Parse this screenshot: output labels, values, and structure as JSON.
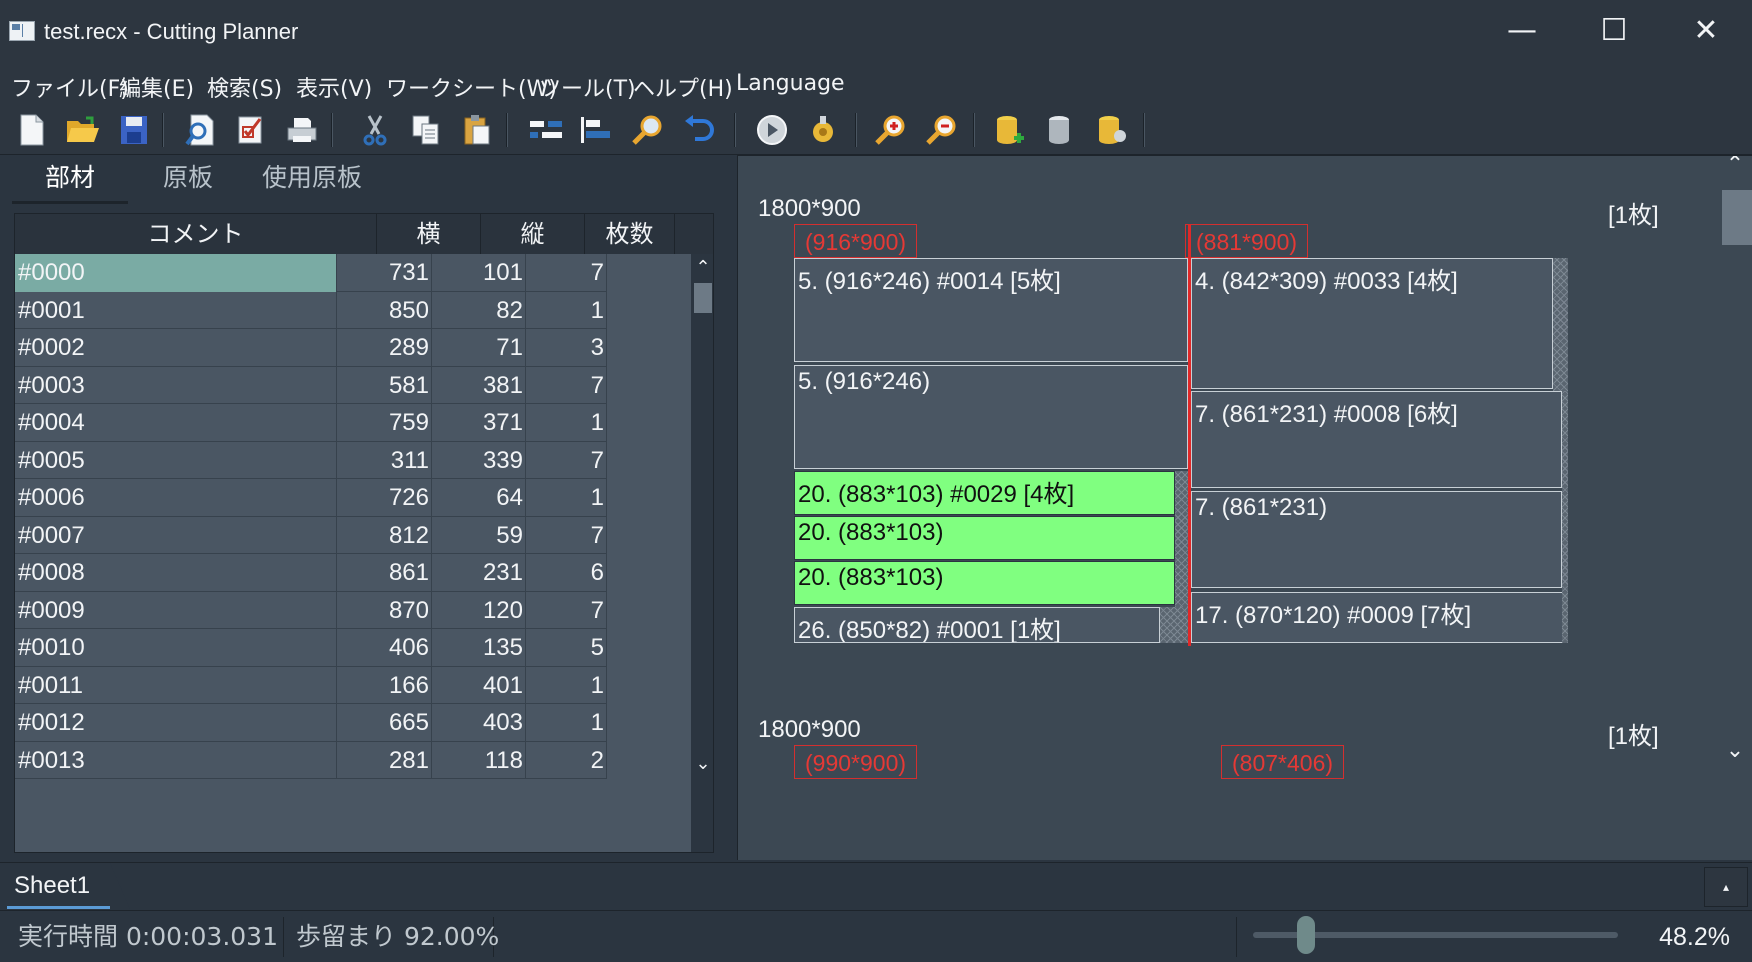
{
  "window": {
    "title": "test.recx - Cutting Planner",
    "minimize_glyph": "—",
    "maximize_glyph": "☐",
    "close_glyph": "✕"
  },
  "menu": [
    "ファイル(F)",
    "編集(E)",
    "検索(S)",
    "表示(V)",
    "ワークシート(W)",
    "ツール(T)",
    "ヘルプ(H)",
    "Language"
  ],
  "toolbar": {
    "icons": [
      "new-file-icon",
      "open-folder-icon",
      "save-icon",
      "print-preview-icon",
      "checklist-icon",
      "print-icon",
      "cut-icon",
      "copy-icon",
      "paste-icon",
      "align-center-icon",
      "align-left-icon",
      "search-icon",
      "undo-icon",
      "run-icon",
      "settings-gear-icon",
      "zoom-in-icon",
      "zoom-out-icon",
      "add-database-icon",
      "database-icon",
      "database-settings-icon"
    ]
  },
  "left_tabs": [
    "部材",
    "原板",
    "使用原板"
  ],
  "grid": {
    "headers": [
      "コメント",
      "横",
      "縦",
      "枚数"
    ],
    "rows": [
      [
        "#0000",
        "731",
        "101",
        "7"
      ],
      [
        "#0001",
        "850",
        "82",
        "1"
      ],
      [
        "#0002",
        "289",
        "71",
        "3"
      ],
      [
        "#0003",
        "581",
        "381",
        "7"
      ],
      [
        "#0004",
        "759",
        "371",
        "1"
      ],
      [
        "#0005",
        "311",
        "339",
        "7"
      ],
      [
        "#0006",
        "726",
        "64",
        "1"
      ],
      [
        "#0007",
        "812",
        "59",
        "7"
      ],
      [
        "#0008",
        "861",
        "231",
        "6"
      ],
      [
        "#0009",
        "870",
        "120",
        "7"
      ],
      [
        "#0010",
        "406",
        "135",
        "5"
      ],
      [
        "#0011",
        "166",
        "401",
        "1"
      ],
      [
        "#0012",
        "665",
        "403",
        "1"
      ],
      [
        "#0013",
        "281",
        "118",
        "2"
      ]
    ],
    "scroll_up": "⌃",
    "scroll_down": "⌄"
  },
  "layout_view": {
    "sheet1": {
      "size": "1800*900",
      "count": "[1枚]",
      "strip_left": "(916*900)",
      "strip_right": "(881*900)",
      "parts": [
        "5. (916*246) #0014 [5枚]",
        "5. (916*246)",
        "20. (883*103) #0029 [4枚]",
        "20. (883*103)",
        "20. (883*103)",
        "26. (850*82) #0001 [1枚]",
        "4. (842*309) #0033 [4枚]",
        "7. (861*231) #0008 [6枚]",
        "7. (861*231)",
        "17. (870*120) #0009 [7枚]"
      ]
    },
    "sheet2": {
      "size": "1800*900",
      "count": "[1枚]",
      "strip_left": "(990*900)",
      "strip_right": "(807*406)"
    },
    "scroll_up": "⌃",
    "scroll_down": "⌄"
  },
  "sheet_tabs": [
    "Sheet1"
  ],
  "sheet_scroll_glyph": "▴",
  "status": {
    "exec_time": "実行時間 0:00:03.031",
    "yield": "歩留まり 92.00%",
    "zoom": "48.2%",
    "zoom_fraction": 0.12
  },
  "colors": {
    "highlight_part": "#80ff80",
    "selected_row": "#7aaba4",
    "cut_line": "#e02828"
  }
}
